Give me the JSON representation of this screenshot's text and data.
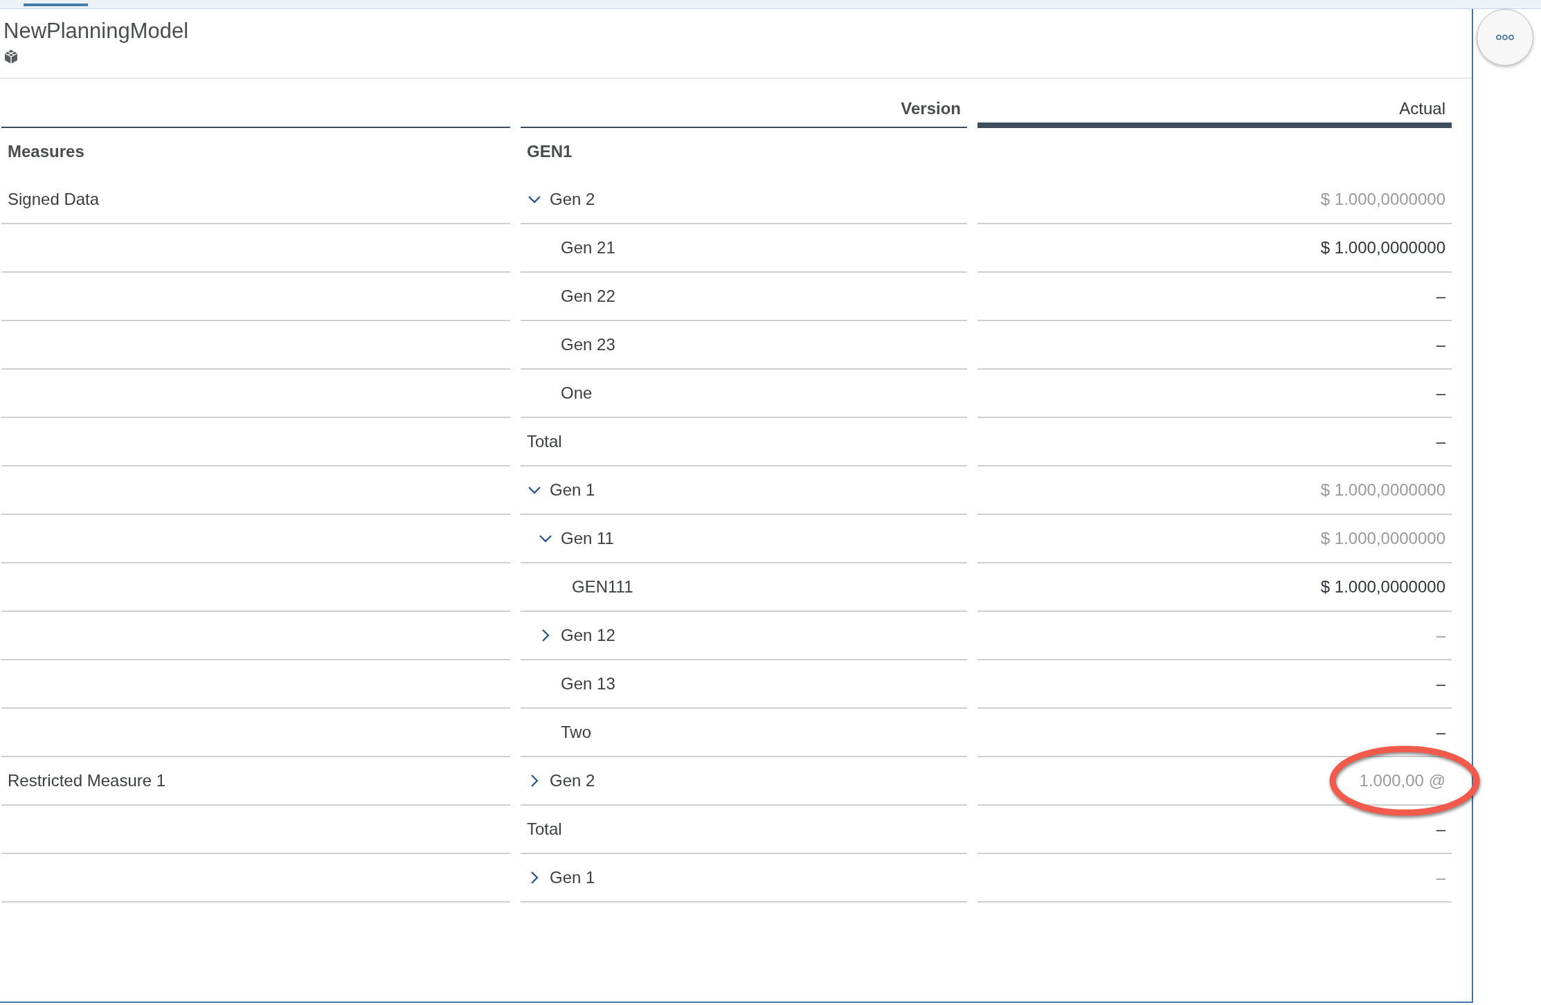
{
  "widget": {
    "title": "NewPlanningModel"
  },
  "table": {
    "column_headers": [
      "Version",
      "Actual"
    ],
    "dimension_header": "Measures",
    "version_header": "GEN1",
    "measures": [
      {
        "name": "Signed Data",
        "rows": [
          {
            "label": "Gen 2",
            "expanded": true,
            "value": "$ 1.000,0000000",
            "muted": true,
            "children": [
              {
                "label": "Gen 21",
                "value": "$ 1.000,0000000",
                "muted": false
              },
              {
                "label": "Gen 22",
                "value": "–",
                "muted": false
              },
              {
                "label": "Gen 23",
                "value": "–",
                "muted": false
              },
              {
                "label": "One",
                "value": "–",
                "muted": false
              }
            ]
          },
          {
            "label": "Total",
            "value": "–",
            "muted": false
          },
          {
            "label": "Gen 1",
            "expanded": true,
            "value": "$ 1.000,0000000",
            "muted": true,
            "children": [
              {
                "label": "Gen 11",
                "expanded": true,
                "value": "$ 1.000,0000000",
                "muted": true,
                "children": [
                  {
                    "label": "GEN111",
                    "value": "$ 1.000,0000000",
                    "muted": false
                  }
                ]
              },
              {
                "label": "Gen 12",
                "expanded": false,
                "value": "–",
                "muted": true
              },
              {
                "label": "Gen 13",
                "value": "–",
                "muted": false
              },
              {
                "label": "Two",
                "value": "–",
                "muted": false
              }
            ]
          }
        ]
      },
      {
        "name": "Restricted Measure 1",
        "rows": [
          {
            "label": "Gen 2",
            "expanded": false,
            "value": "1.000,00 @",
            "muted": true,
            "highlighted": true
          },
          {
            "label": "Total",
            "value": "–",
            "muted": false
          },
          {
            "label": "Gen 1",
            "expanded": false,
            "value": "–",
            "muted": true
          }
        ]
      }
    ]
  }
}
